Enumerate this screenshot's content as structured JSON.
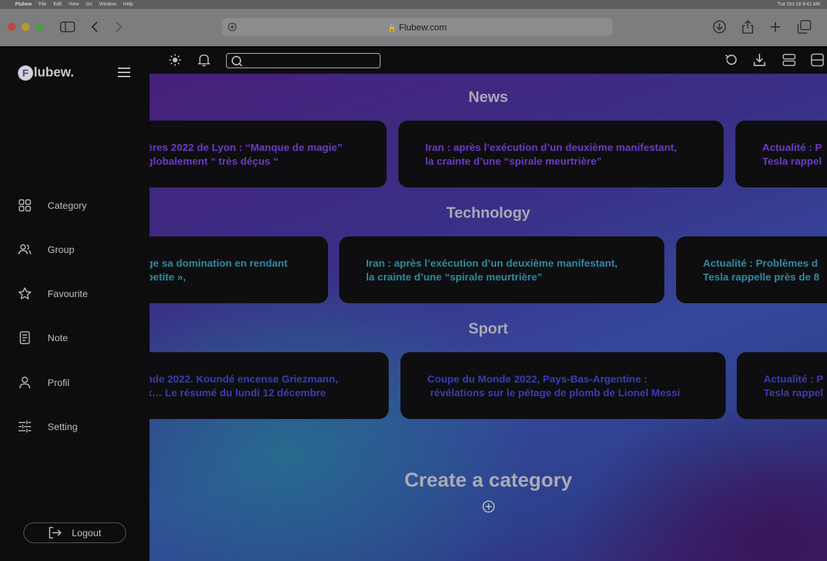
{
  "menubar": {
    "app": "Flubew",
    "items": [
      "File",
      "Edit",
      "View",
      "Go",
      "Window",
      "Help"
    ],
    "datetime": "Tue Oct 18  9:41 AM"
  },
  "browser": {
    "url": "Flubew.com"
  },
  "brand": {
    "logo_letter": "F",
    "name": "lubew."
  },
  "sidebar": {
    "items": [
      {
        "label": "Category",
        "icon": "grid-icon"
      },
      {
        "label": "Group",
        "icon": "users-icon"
      },
      {
        "label": "Favourite",
        "icon": "star-icon"
      },
      {
        "label": "Note",
        "icon": "note-icon"
      },
      {
        "label": "Profil",
        "icon": "user-icon"
      },
      {
        "label": "Setting",
        "icon": "sliders-icon"
      }
    ],
    "logout": "Logout"
  },
  "search": {
    "placeholder": ""
  },
  "sections": [
    {
      "title": "News",
      "cards": [
        [
          "ères 2022 de Lyon : “Manque de magie”",
          "globalement “ très déçus “"
        ],
        [
          "Iran : après l’exécution d’un deuxième manifestant,",
          "la crainte d’une “spirale meurtrière”"
        ],
        [
          "Actualité : P",
          "Tesla rappel"
        ]
      ]
    },
    {
      "title": "Technology",
      "cards": [
        [
          "ge sa domination en rendant",
          "petite »,"
        ],
        [
          "Iran : après l’exécution d’un deuxième manifestant,",
          "la crainte d’une “spirale meurtrière”"
        ],
        [
          "Actualité : Problèmes d",
          "Tesla rappelle près de 8"
        ]
      ]
    },
    {
      "title": "Sport",
      "cards": [
        [
          "nde 2022. Koundé encense Griezmann,",
          "x… Le résumé du lundi 12 décembre"
        ],
        [
          "Coupe du Monde 2022, Pays-Bas-Argentine :",
          " révélations sur le pétage de plomb de Lionel Messi"
        ],
        [
          "Actualité : P",
          "Tesla rappel"
        ]
      ]
    }
  ],
  "create": {
    "label": "Create a category"
  }
}
